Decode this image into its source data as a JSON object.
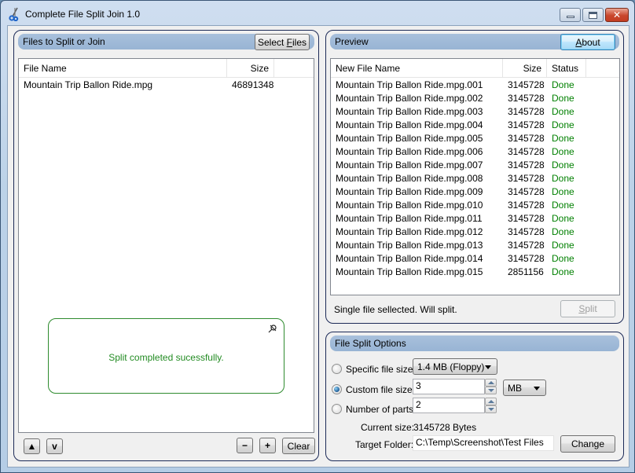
{
  "window": {
    "title": "Complete File Split Join 1.0",
    "icon": "scissors-icon",
    "controls": [
      "minimize",
      "maximize",
      "close"
    ]
  },
  "files_panel": {
    "header": "Files to Split or Join",
    "select_files_button": "Select Files",
    "columns": [
      "File Name",
      "Size"
    ],
    "rows": [
      {
        "name": "Mountain Trip Ballon Ride.mpg",
        "size": "46891348"
      }
    ],
    "notice": {
      "text": "Split completed sucessfully.",
      "icon": "pin-icon",
      "color": "#228b22"
    },
    "buttons": {
      "move_up": "^",
      "move_down": "v",
      "remove": "−",
      "add": "+",
      "clear": "Clear"
    }
  },
  "preview_panel": {
    "header": "Preview",
    "about_button": "About",
    "columns": [
      "New File Name",
      "Size",
      "Status"
    ],
    "rows": [
      {
        "name": "Mountain Trip Ballon Ride.mpg.001",
        "size": "3145728",
        "status": "Done"
      },
      {
        "name": "Mountain Trip Ballon Ride.mpg.002",
        "size": "3145728",
        "status": "Done"
      },
      {
        "name": "Mountain Trip Ballon Ride.mpg.003",
        "size": "3145728",
        "status": "Done"
      },
      {
        "name": "Mountain Trip Ballon Ride.mpg.004",
        "size": "3145728",
        "status": "Done"
      },
      {
        "name": "Mountain Trip Ballon Ride.mpg.005",
        "size": "3145728",
        "status": "Done"
      },
      {
        "name": "Mountain Trip Ballon Ride.mpg.006",
        "size": "3145728",
        "status": "Done"
      },
      {
        "name": "Mountain Trip Ballon Ride.mpg.007",
        "size": "3145728",
        "status": "Done"
      },
      {
        "name": "Mountain Trip Ballon Ride.mpg.008",
        "size": "3145728",
        "status": "Done"
      },
      {
        "name": "Mountain Trip Ballon Ride.mpg.009",
        "size": "3145728",
        "status": "Done"
      },
      {
        "name": "Mountain Trip Ballon Ride.mpg.010",
        "size": "3145728",
        "status": "Done"
      },
      {
        "name": "Mountain Trip Ballon Ride.mpg.011",
        "size": "3145728",
        "status": "Done"
      },
      {
        "name": "Mountain Trip Ballon Ride.mpg.012",
        "size": "3145728",
        "status": "Done"
      },
      {
        "name": "Mountain Trip Ballon Ride.mpg.013",
        "size": "3145728",
        "status": "Done"
      },
      {
        "name": "Mountain Trip Ballon Ride.mpg.014",
        "size": "3145728",
        "status": "Done"
      },
      {
        "name": "Mountain Trip Ballon Ride.mpg.015",
        "size": "2851156",
        "status": "Done"
      }
    ],
    "status_text": "Single file sellected. Will split.",
    "split_button": "Split",
    "status_color": "#008000"
  },
  "options_panel": {
    "header": "File Split Options",
    "specific_size": {
      "label": "Specific file size:",
      "selected": false,
      "value": "1.4  MB (Floppy)"
    },
    "custom_size": {
      "label": "Custom file size:",
      "selected": true,
      "value": "3",
      "unit": "MB"
    },
    "number_of_parts": {
      "label": "Number of parts:",
      "selected": false,
      "value": "2"
    },
    "current_size": {
      "label": "Current size:",
      "value": "3145728 Bytes"
    },
    "target_folder": {
      "label": "Target Folder:",
      "value": "C:\\Temp\\Screenshot\\Test Files"
    },
    "change_button": "Change"
  }
}
